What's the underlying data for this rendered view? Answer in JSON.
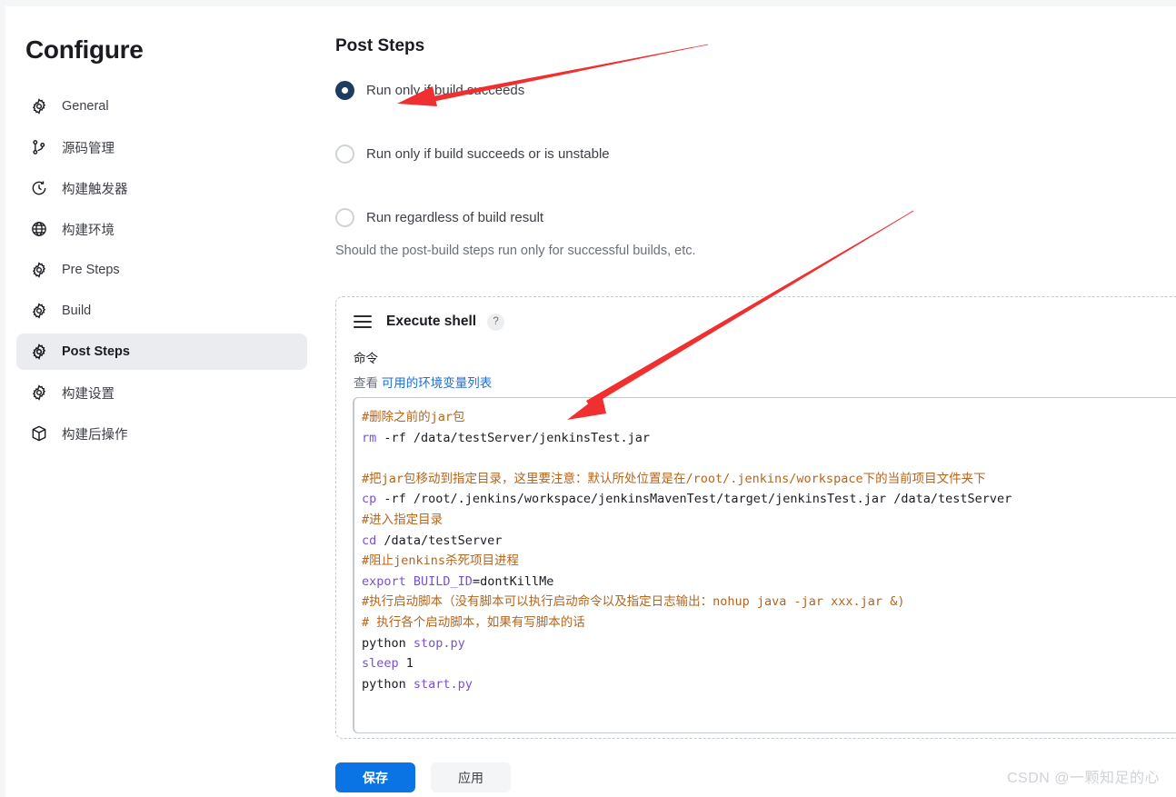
{
  "sidebar": {
    "title": "Configure",
    "items": [
      {
        "label": "General",
        "icon": "gear-icon",
        "active": false
      },
      {
        "label": "源码管理",
        "icon": "git-branch-icon",
        "active": false
      },
      {
        "label": "构建触发器",
        "icon": "clock-icon",
        "active": false
      },
      {
        "label": "构建环境",
        "icon": "globe-icon",
        "active": false
      },
      {
        "label": "Pre Steps",
        "icon": "gear-icon",
        "active": false
      },
      {
        "label": "Build",
        "icon": "gear-icon",
        "active": false
      },
      {
        "label": "Post Steps",
        "icon": "gear-icon",
        "active": true
      },
      {
        "label": "构建设置",
        "icon": "gear-icon",
        "active": false
      },
      {
        "label": "构建后操作",
        "icon": "package-icon",
        "active": false
      }
    ]
  },
  "main": {
    "title": "Post Steps",
    "radios": [
      {
        "label": "Run only if build succeeds",
        "selected": true
      },
      {
        "label": "Run only if build succeeds or is unstable",
        "selected": false
      },
      {
        "label": "Run regardless of build result",
        "selected": false
      }
    ],
    "help_note": "Should the post-build steps run only for successful builds, etc.",
    "step": {
      "drag_handle_icon": "drag-handle-icon",
      "title": "Execute shell",
      "help_badge": "?",
      "field_label": "命令",
      "env_prefix": "查看",
      "env_link": "可用的环境变量列表",
      "code_lines": [
        {
          "type": "comment",
          "text": "#删除之前的jar包"
        },
        {
          "type": "code",
          "cmd": "rm",
          "args": " -rf /data/testServer/jenkinsTest.jar"
        },
        {
          "type": "blank",
          "text": ""
        },
        {
          "type": "comment",
          "text": "#把jar包移动到指定目录，这里要注意：默认所处位置是在/root/.jenkins/workspace下的当前项目文件夹下"
        },
        {
          "type": "code",
          "cmd": "cp",
          "args": " -rf /root/.jenkins/workspace/jenkinsMavenTest/target/jenkinsTest.jar /data/testServer"
        },
        {
          "type": "comment",
          "text": "#进入指定目录"
        },
        {
          "type": "code",
          "cmd": "cd",
          "args": " /data/testServer"
        },
        {
          "type": "comment",
          "text": "#阻止jenkins杀死项目进程"
        },
        {
          "type": "code",
          "cmd": "export",
          "args": " BUILD_ID=dontKillMe",
          "kwarg": "BUILD_ID"
        },
        {
          "type": "comment",
          "text": "#执行启动脚本（没有脚本可以执行启动命令以及指定日志输出：nohup java -jar xxx.jar &)"
        },
        {
          "type": "comment",
          "text": "# 执行各个启动脚本，如果有写脚本的话"
        },
        {
          "type": "code",
          "cmd": "python",
          "args": " stop.py",
          "plainfirst": true
        },
        {
          "type": "code",
          "cmd": "sleep",
          "args": " 1"
        },
        {
          "type": "code",
          "cmd": "python",
          "args": " start.py",
          "plainfirst": true
        }
      ]
    }
  },
  "footer": {
    "save_label": "保存",
    "apply_label": "应用"
  },
  "watermark": "CSDN @一颗知足的心",
  "colors": {
    "primary_button": "#0b74e5",
    "radio_selected": "#1c3e5e",
    "link": "#1f6fd0",
    "annotation_arrow": "#f03030",
    "sidebar_active_bg": "#ebecef",
    "comment_text": "#b5651d",
    "keyword_text": "#7a4fd6"
  },
  "annotations": [
    {
      "name": "arrow-to-run-only-if-build-succeeds",
      "color": "#f03030"
    },
    {
      "name": "arrow-to-code-editor",
      "color": "#f03030"
    }
  ]
}
